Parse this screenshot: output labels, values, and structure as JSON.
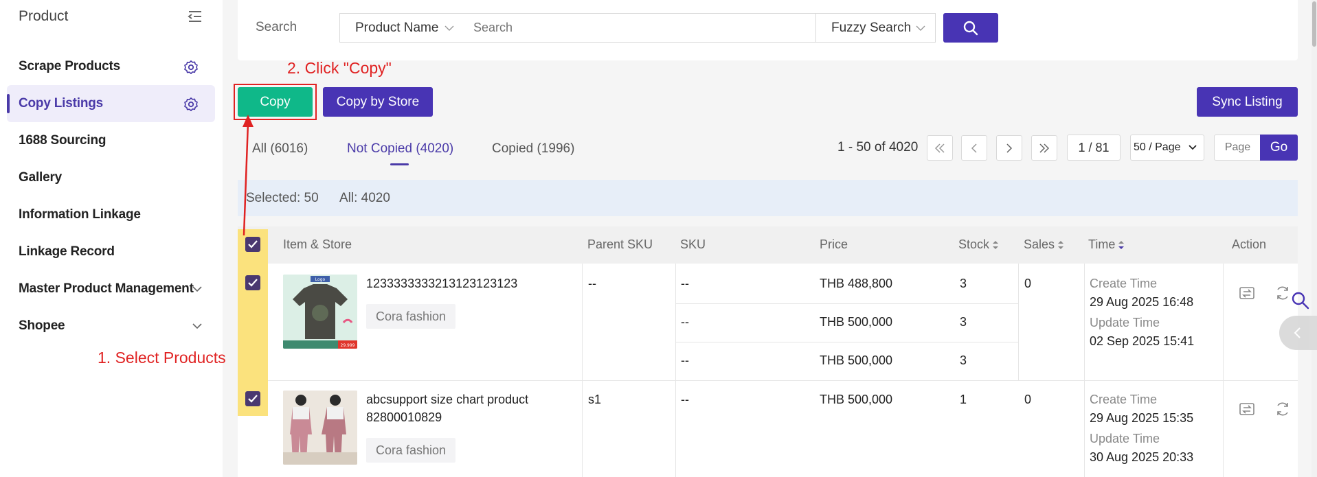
{
  "sidebar": {
    "title": "Product",
    "items": [
      {
        "label": "Scrape Products"
      },
      {
        "label": "Copy Listings"
      },
      {
        "label": "1688 Sourcing"
      },
      {
        "label": "Gallery"
      },
      {
        "label": "Information Linkage"
      },
      {
        "label": "Linkage Record"
      },
      {
        "label": "Master Product Management"
      },
      {
        "label": "Shopee"
      }
    ]
  },
  "search": {
    "label": "Search",
    "field_select": "Product Name",
    "placeholder": "Search",
    "mode_select": "Fuzzy Search"
  },
  "toolbar": {
    "copy_label": "Copy",
    "copy_by_store_label": "Copy by Store",
    "sync_label": "Sync Listing"
  },
  "annotations": {
    "step1": "1. Select Products",
    "step2": "2. Click \"Copy\""
  },
  "tabs": [
    {
      "label": "All (6016)"
    },
    {
      "label": "Not Copied (4020)"
    },
    {
      "label": "Copied (1996)"
    }
  ],
  "pagination": {
    "range": "1 - 50 of 4020",
    "current": "1 / 81",
    "page_size": "50 / Page",
    "page_placeholder": "Page",
    "go_label": "Go"
  },
  "selection": {
    "selected": "Selected: 50",
    "all": "All: 4020"
  },
  "table": {
    "headers": {
      "item": "Item & Store",
      "parent_sku": "Parent SKU",
      "sku": "SKU",
      "price": "Price",
      "stock": "Stock",
      "sales": "Sales",
      "time": "Time",
      "action": "Action"
    },
    "rows": [
      {
        "title": "1233333333213123123123",
        "store": "Cora fashion",
        "parent_sku": "--",
        "variants": [
          {
            "sku": "--",
            "price": "THB 488,800",
            "stock": "3"
          },
          {
            "sku": "--",
            "price": "THB 500,000",
            "stock": "3"
          },
          {
            "sku": "--",
            "price": "THB 500,000",
            "stock": "3"
          }
        ],
        "sales": "0",
        "create_label": "Create Time",
        "create_time": "29 Aug 2025 16:48",
        "update_label": "Update Time",
        "update_time": "02 Sep 2025 15:41"
      },
      {
        "title_line1": "abcsupport size chart product",
        "title_line2": "82800010829",
        "store": "Cora fashion",
        "parent_sku": "s1",
        "variants": [
          {
            "sku": "--",
            "price": "THB 500,000",
            "stock": "1"
          }
        ],
        "sales": "0",
        "create_label": "Create Time",
        "create_time": "29 Aug 2025 15:35",
        "update_label": "Update Time",
        "update_time": "30 Aug 2025 20:33"
      }
    ]
  },
  "thumb1": {
    "label": "Logo",
    "price": "29.999"
  },
  "colors": {
    "primary": "#4834b4",
    "copy_green": "#0fb889",
    "annotation_red": "#e02222",
    "highlight": "#fbe27d"
  }
}
